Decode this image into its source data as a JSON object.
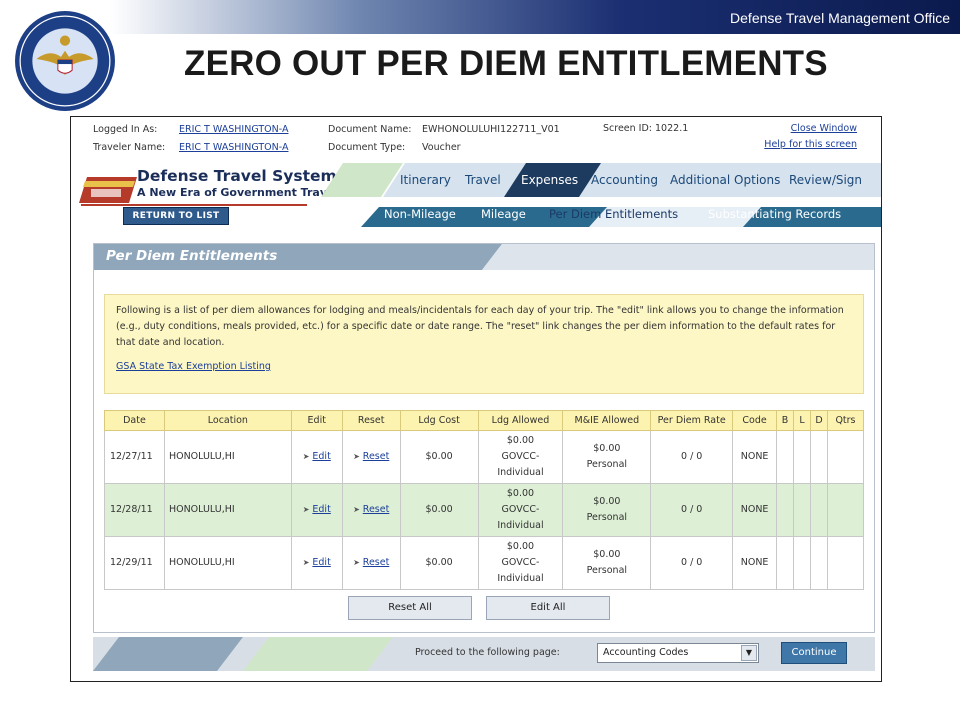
{
  "slide": {
    "org_name": "Defense Travel Management Office",
    "title": "ZERO OUT PER DIEM ENTITLEMENTS",
    "seal_icon": "dtmo-seal-icon"
  },
  "login": {
    "logged_in_label": "Logged In As:",
    "logged_in_value": "ERIC T WASHINGTON-A",
    "traveler_label": "Traveler Name:",
    "traveler_value": "ERIC T WASHINGTON-A",
    "doc_name_label": "Document Name:",
    "doc_name_value": "EWHONOLULUHI122711_V01",
    "doc_type_label": "Document Type:",
    "doc_type_value": "Voucher",
    "screen_id": "Screen ID: 1022.1",
    "close_window": "Close Window",
    "help": "Help for this screen"
  },
  "app": {
    "title": "Defense Travel System",
    "subtitle": "A New Era of Government Travel",
    "return_button": "RETURN TO LIST"
  },
  "tabs_primary": [
    {
      "label": "Itinerary",
      "active": false
    },
    {
      "label": "Travel",
      "active": false
    },
    {
      "label": "Expenses",
      "active": true
    },
    {
      "label": "Accounting",
      "active": false
    },
    {
      "label": "Additional Options",
      "active": false
    },
    {
      "label": "Review/Sign",
      "active": false
    }
  ],
  "tabs_secondary": [
    {
      "label": "Non-Mileage",
      "active": false
    },
    {
      "label": "Mileage",
      "active": false
    },
    {
      "label": "Per Diem Entitlements",
      "active": true
    },
    {
      "label": "Substantiating Records",
      "active": false
    }
  ],
  "panel": {
    "title": "Per Diem Entitlements",
    "info_text": "Following is a list of per diem allowances for lodging and meals/incidentals for each day of your trip. The \"edit\" link allows you to change the information (e.g., duty conditions, meals provided, etc.) for a specific date or date range. The \"reset\" link changes the per diem information to the default rates for that date and location.",
    "gsa_link": "GSA State Tax Exemption Listing"
  },
  "table": {
    "headers": [
      "Date",
      "Location",
      "Edit",
      "Reset",
      "Ldg Cost",
      "Ldg Allowed",
      "M&IE Allowed",
      "Per Diem Rate",
      "Code",
      "B",
      "L",
      "D",
      "Qtrs"
    ],
    "rows": [
      {
        "date": "12/27/11",
        "location": "HONOLULU,HI",
        "edit": "Edit",
        "reset": "Reset",
        "ldg_cost": "$0.00",
        "ldg_allowed_1": "$0.00",
        "ldg_allowed_2": "GOVCC-",
        "ldg_allowed_3": "Individual",
        "mie_1": "$0.00",
        "mie_2": "Personal",
        "rate": "0 / 0",
        "code": "NONE"
      },
      {
        "date": "12/28/11",
        "location": "HONOLULU,HI",
        "edit": "Edit",
        "reset": "Reset",
        "ldg_cost": "$0.00",
        "ldg_allowed_1": "$0.00",
        "ldg_allowed_2": "GOVCC-",
        "ldg_allowed_3": "Individual",
        "mie_1": "$0.00",
        "mie_2": "Personal",
        "rate": "0 / 0",
        "code": "NONE"
      },
      {
        "date": "12/29/11",
        "location": "HONOLULU,HI",
        "edit": "Edit",
        "reset": "Reset",
        "ldg_cost": "$0.00",
        "ldg_allowed_1": "$0.00",
        "ldg_allowed_2": "GOVCC-",
        "ldg_allowed_3": "Individual",
        "mie_1": "$0.00",
        "mie_2": "Personal",
        "rate": "0 / 0",
        "code": "NONE"
      }
    ]
  },
  "buttons": {
    "reset_all": "Reset All",
    "edit_all": "Edit All"
  },
  "footer": {
    "proceed_label": "Proceed to the following page:",
    "select_value": "Accounting Codes",
    "continue": "Continue"
  },
  "colors": {
    "navy": "#1b2e5a",
    "tab_blue": "#5b9bbd",
    "active_tab": "#1d3b5f",
    "info_yellow": "#fdf7c6",
    "row_green": "#ddefd5",
    "link_blue": "#1c3f99"
  }
}
